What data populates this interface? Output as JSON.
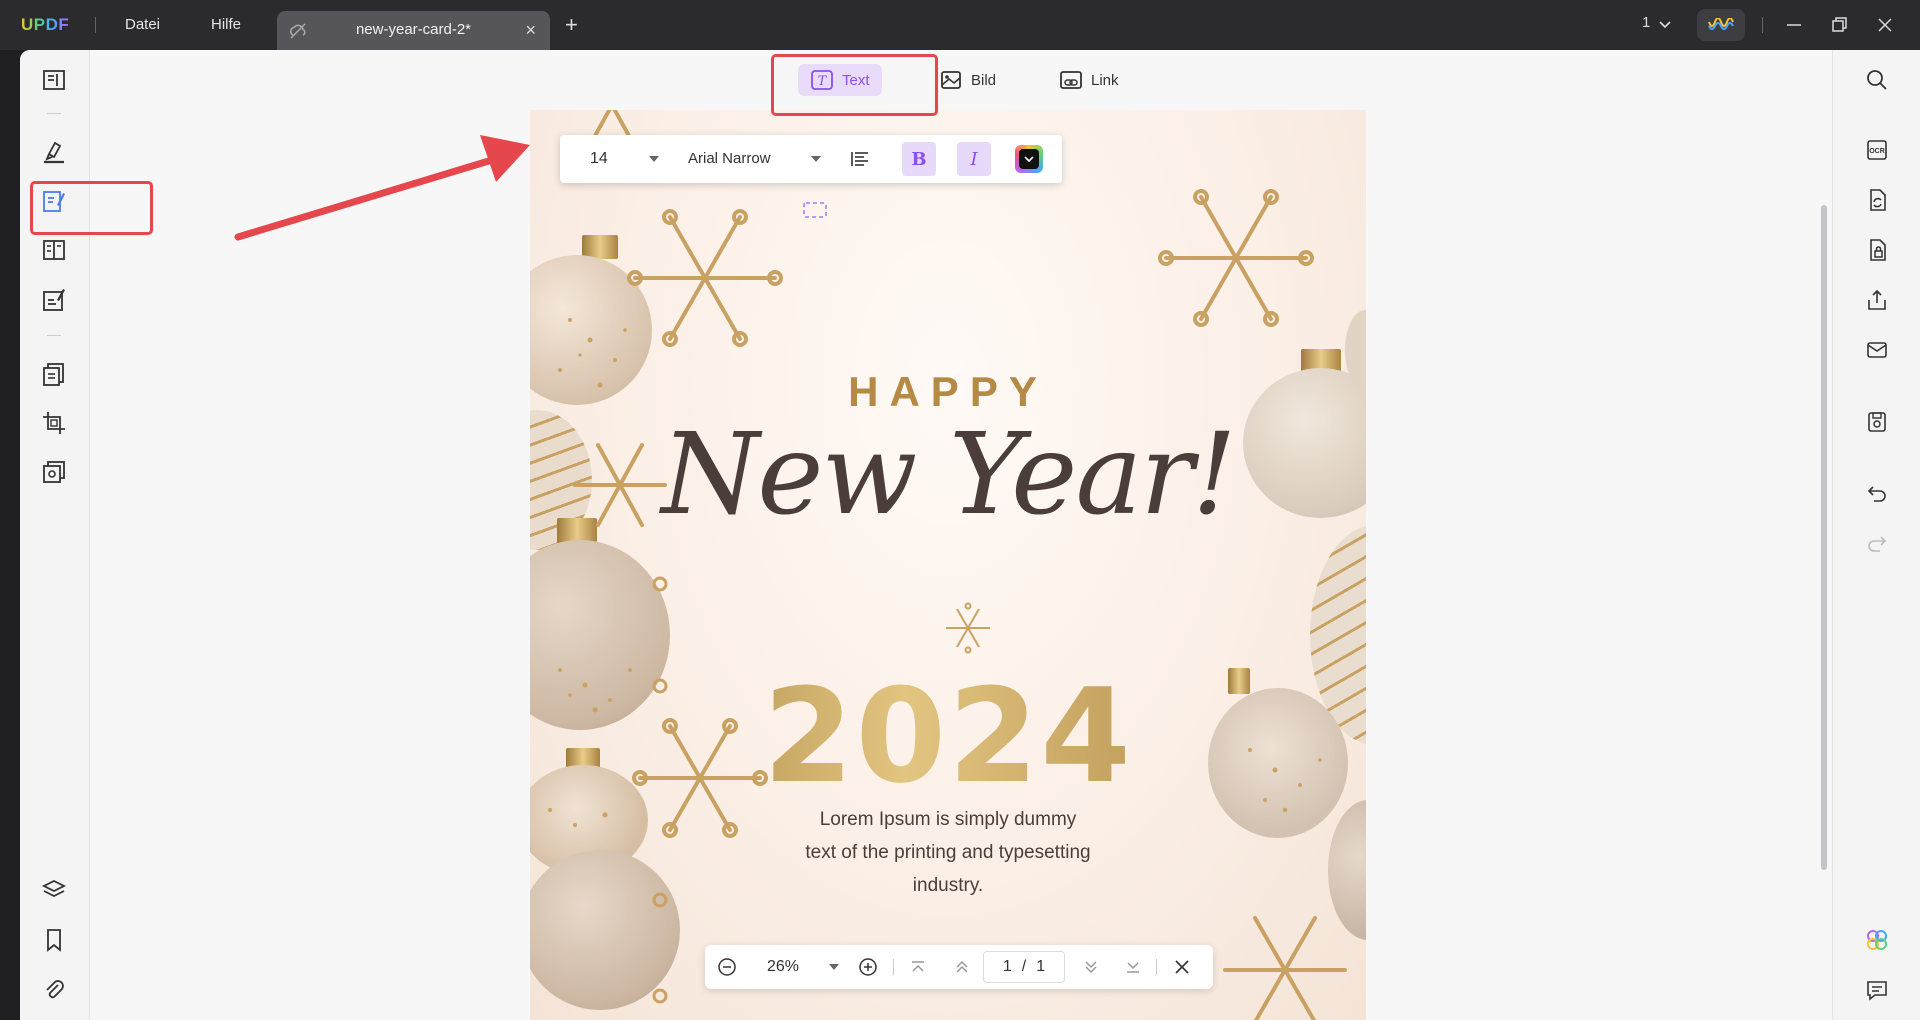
{
  "app": {
    "logo": "UPDF",
    "menu": {
      "file": "Datei",
      "help": "Hilfe"
    },
    "tab": {
      "title": "new-year-card-2*",
      "close": "×",
      "add": "+"
    },
    "window_count": "1"
  },
  "mode_toolbar": {
    "text_label": "Text",
    "image_label": "Bild",
    "link_label": "Link"
  },
  "format_toolbar": {
    "font_size": "14",
    "font_family": "Arial Narrow",
    "bold_label": "B",
    "italic_label": "I"
  },
  "document": {
    "happy": "HAPPY",
    "new_year": "New Year!",
    "year": "2024",
    "body_line1": "Lorem Ipsum is simply dummy",
    "body_line2": "text of the printing and typesetting",
    "body_line3": "industry."
  },
  "zoom_bar": {
    "zoom": "26%",
    "current_page": "1",
    "separator": "/",
    "total_pages": "1"
  },
  "colors": {
    "accent": "#8a4ff0",
    "annotation": "#e5474c",
    "gold": "#c29b4d"
  }
}
